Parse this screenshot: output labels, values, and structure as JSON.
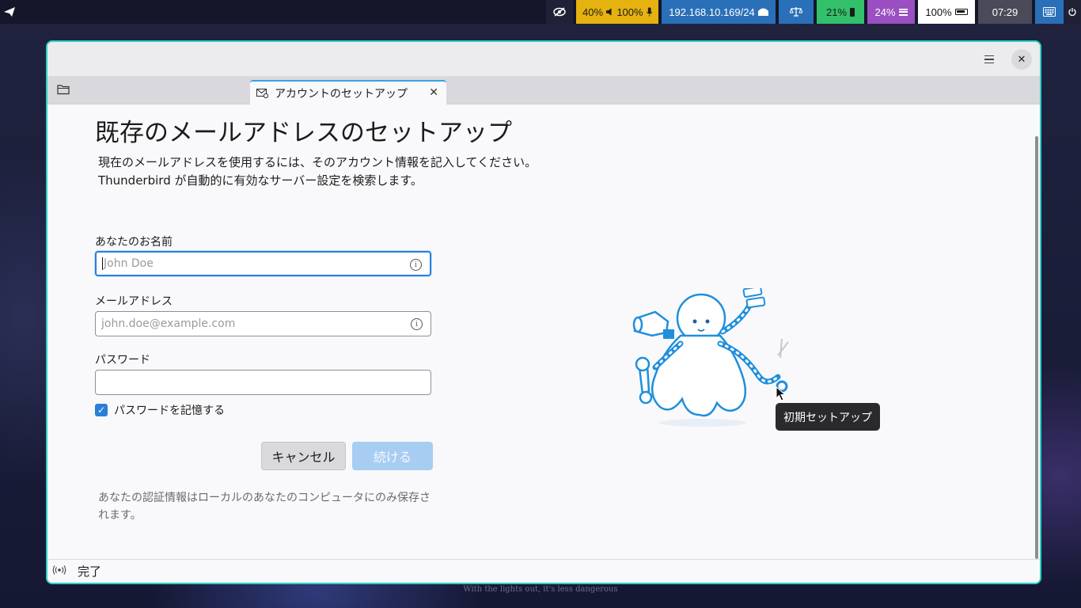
{
  "wallpaper": {
    "caption": "With the lights out, it's less dangerous"
  },
  "topbar": {
    "volume_text": "40%",
    "mic_text": "100%",
    "network_text": "192.168.10.169/24",
    "battery_text": "21%",
    "cpu_text": "24%",
    "brightness_text": "100%",
    "clock_text": "07:29",
    "colors": {
      "volume": "#e5b20f",
      "network": "#2a70b8",
      "battery": "#33c06a",
      "cpu": "#9a4fc2",
      "clock": "#4a4a58"
    }
  },
  "window": {
    "accent_border": "#2ad0c6",
    "tab": {
      "label": "アカウントのセットアップ",
      "icon": "mail-settings-icon"
    },
    "page_title": "既存のメールアドレスのセットアップ",
    "intro_line1": "現在のメールアドレスを使用するには、そのアカウント情報を記入してください。",
    "intro_line2": "Thunderbird が自動的に有効なサーバー設定を検索します。",
    "form": {
      "name_label": "あなたのお名前",
      "name_placeholder": "John Doe",
      "name_value": "",
      "email_label": "メールアドレス",
      "email_placeholder": "john.doe@example.com",
      "email_value": "",
      "password_label": "パスワード",
      "password_value": "",
      "remember_label": "パスワードを記憶する",
      "remember_checked": true
    },
    "buttons": {
      "cancel": "キャンセル",
      "continue": "続ける"
    },
    "privacy_note": "あなたの認証情報はローカルのあなたのコンピュータにのみ保存されます。",
    "tooltip": "初期セットアップ",
    "status": "完了"
  }
}
